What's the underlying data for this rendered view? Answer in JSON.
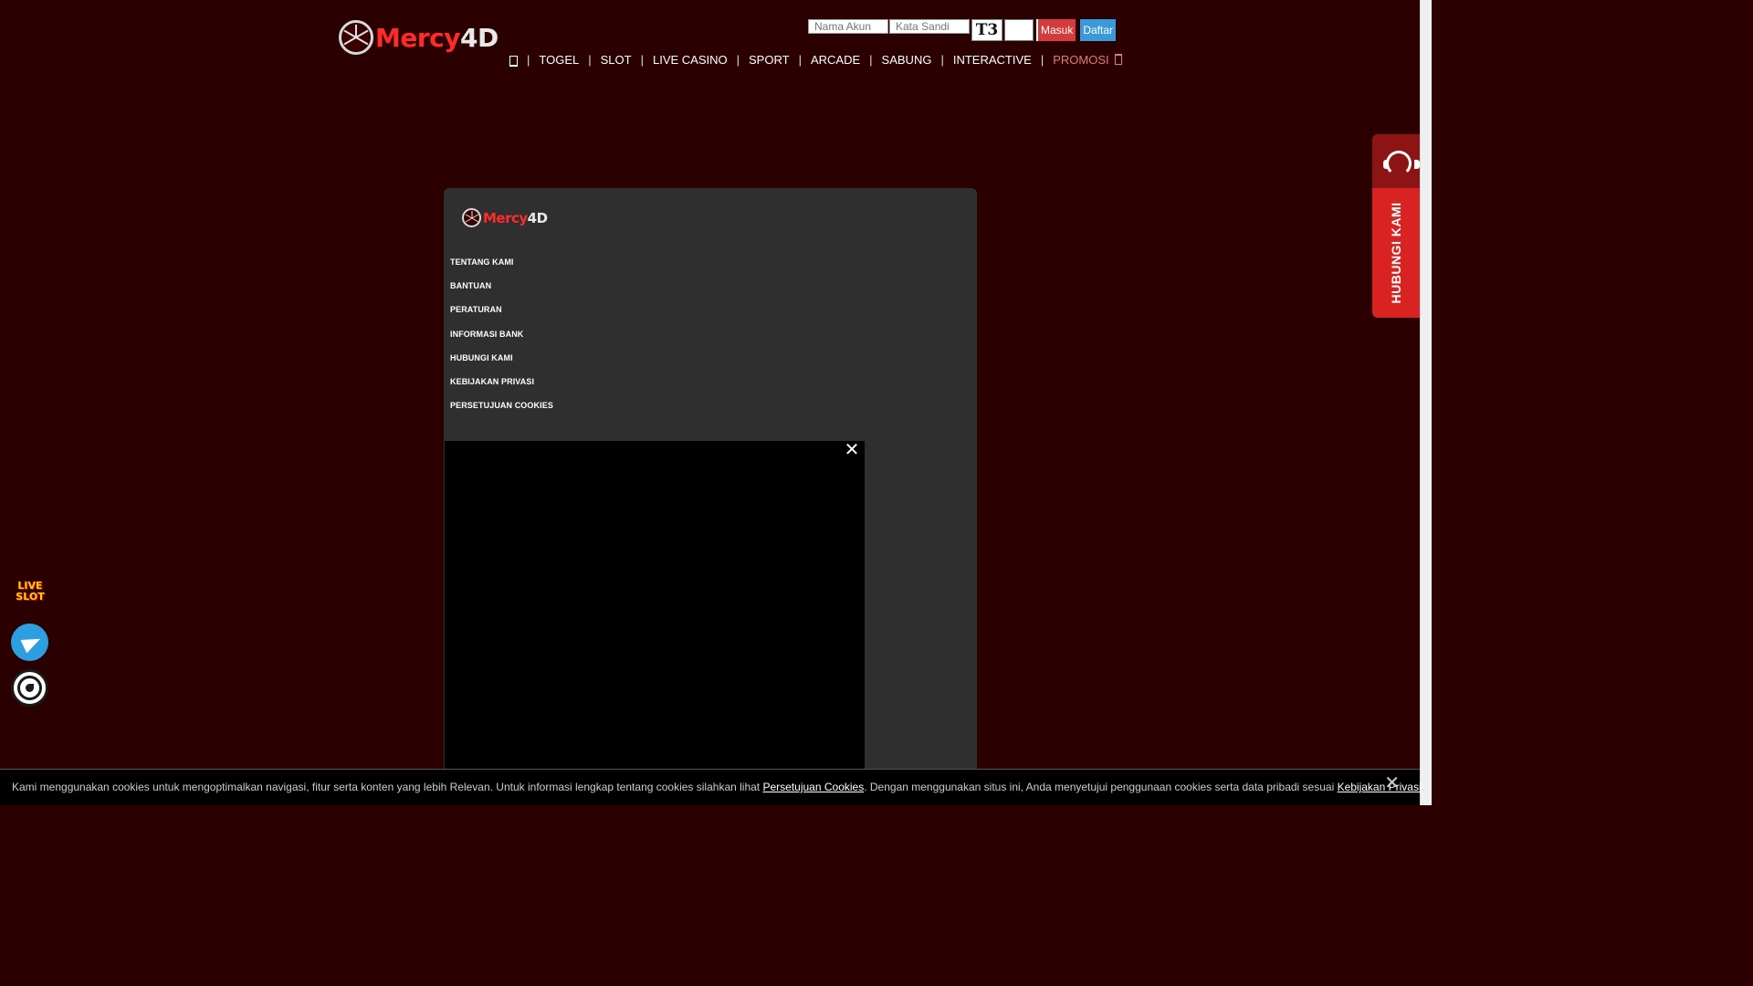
{
  "brand": {
    "logo_primary": "Mercy",
    "logo_secondary": "4D",
    "accent": "#ff2a2a"
  },
  "login": {
    "username_placeholder": "Nama Akun",
    "password_placeholder": "Kata Sandi",
    "captcha_text": "T3",
    "login_label": "Masuk",
    "register_label": "Daftar"
  },
  "nav": {
    "home_icon": "home-icon",
    "items": [
      "TOGEL",
      "SLOT",
      "LIVE CASINO",
      "SPORT",
      "ARCADE",
      "SABUNG",
      "INTERACTIVE",
      "PROMOSI"
    ],
    "separator": "|"
  },
  "footer_menu": {
    "items": [
      "TENTANG KAMI",
      "BANTUAN",
      "PERATURAN",
      "INFORMASI BANK",
      "HUBUNGI KAMI",
      "KEBIJAKAN PRIVASI",
      "PERSETUJUAN COOKIES"
    ]
  },
  "video": {
    "close_icon": "close-icon",
    "close_glyph": "✕"
  },
  "contact_widget": {
    "label": "HUBUNGI KAMI",
    "icon": "headset-icon"
  },
  "floating": {
    "live_slot_line1": "LIVE",
    "live_slot_line2": "SLOT",
    "telegram_icon": "telegram-icon",
    "whatsapp_icon": "whatsapp-icon"
  },
  "cookie": {
    "text_part1": "Kami menggunakan cookies untuk mengoptimalkan navigasi, fitur serta konten yang lebih Relevan. Untuk informasi lengkap tentang cookies silahkan lihat ",
    "link1": "Persetujuan Cookies",
    "text_part2": ". Dengan menggunakan situs ini, Anda menyetujui penggunaan cookies serta data pribadi sesuai ",
    "link2": "Kebijakan Privasi",
    "text_part3": ".",
    "close_glyph": "✕"
  }
}
